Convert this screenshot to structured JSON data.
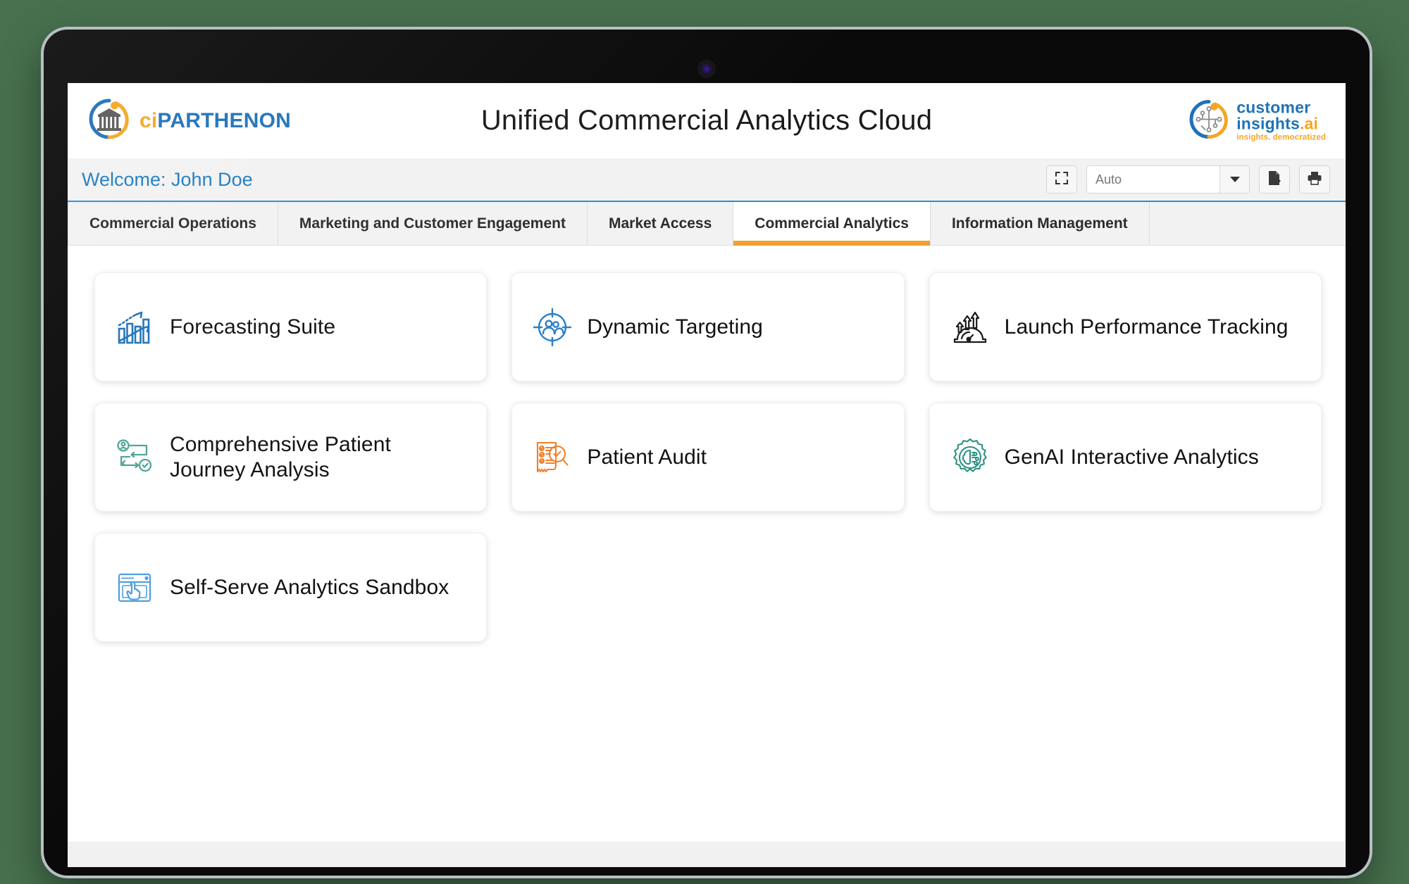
{
  "brand_left": {
    "prefix": "ci",
    "name": "PARTHENON",
    "icon": "greek-temple-circle-logo"
  },
  "header": {
    "title": "Unified Commercial Analytics Cloud"
  },
  "brand_right": {
    "line1": "customer",
    "line2_main": "insights",
    "line2_suffix": ".ai",
    "tagline": "insights. democratized",
    "icon": "network-nodes-circle-logo"
  },
  "welcome": {
    "text": "Welcome: John Doe"
  },
  "toolbar": {
    "fullscreen_icon": "fullscreen-icon",
    "select_value": "Auto",
    "select_caret_icon": "chevron-down-icon",
    "export_icon": "export-file-icon",
    "print_icon": "print-icon"
  },
  "tabs": [
    {
      "label": "Commercial Operations",
      "active": false
    },
    {
      "label": "Marketing and Customer Engagement",
      "active": false
    },
    {
      "label": "Market Access",
      "active": false
    },
    {
      "label": "Commercial Analytics",
      "active": true
    },
    {
      "label": "Information Management",
      "active": false
    }
  ],
  "accent_colors": {
    "active_tab_underline": "#f0a030",
    "brand_blue": "#1f72b8",
    "brand_orange": "#f5a623",
    "welcome_blue": "#1f7cc0",
    "desktop_background": "#47714e"
  },
  "cards": [
    {
      "label": "Forecasting Suite",
      "icon": "bar-chart-trend-icon",
      "color": "#1f72b8"
    },
    {
      "label": "Dynamic Targeting",
      "icon": "target-audience-icon",
      "color": "#2a7fc9"
    },
    {
      "label": "Launch Performance Tracking",
      "icon": "launch-gauge-icon",
      "color": "#1a1a1a"
    },
    {
      "label": "Comprehensive Patient Journey Analysis",
      "icon": "patient-journey-flow-icon",
      "color": "#4fa396"
    },
    {
      "label": "Patient Audit",
      "icon": "audit-checklist-magnifier-icon",
      "color": "#f0802a"
    },
    {
      "label": "GenAI Interactive Analytics",
      "icon": "ai-brain-gear-icon",
      "color": "#2e9284"
    },
    {
      "label": "Self-Serve Analytics Sandbox",
      "icon": "browser-click-icon",
      "color": "#4b9ede"
    }
  ]
}
